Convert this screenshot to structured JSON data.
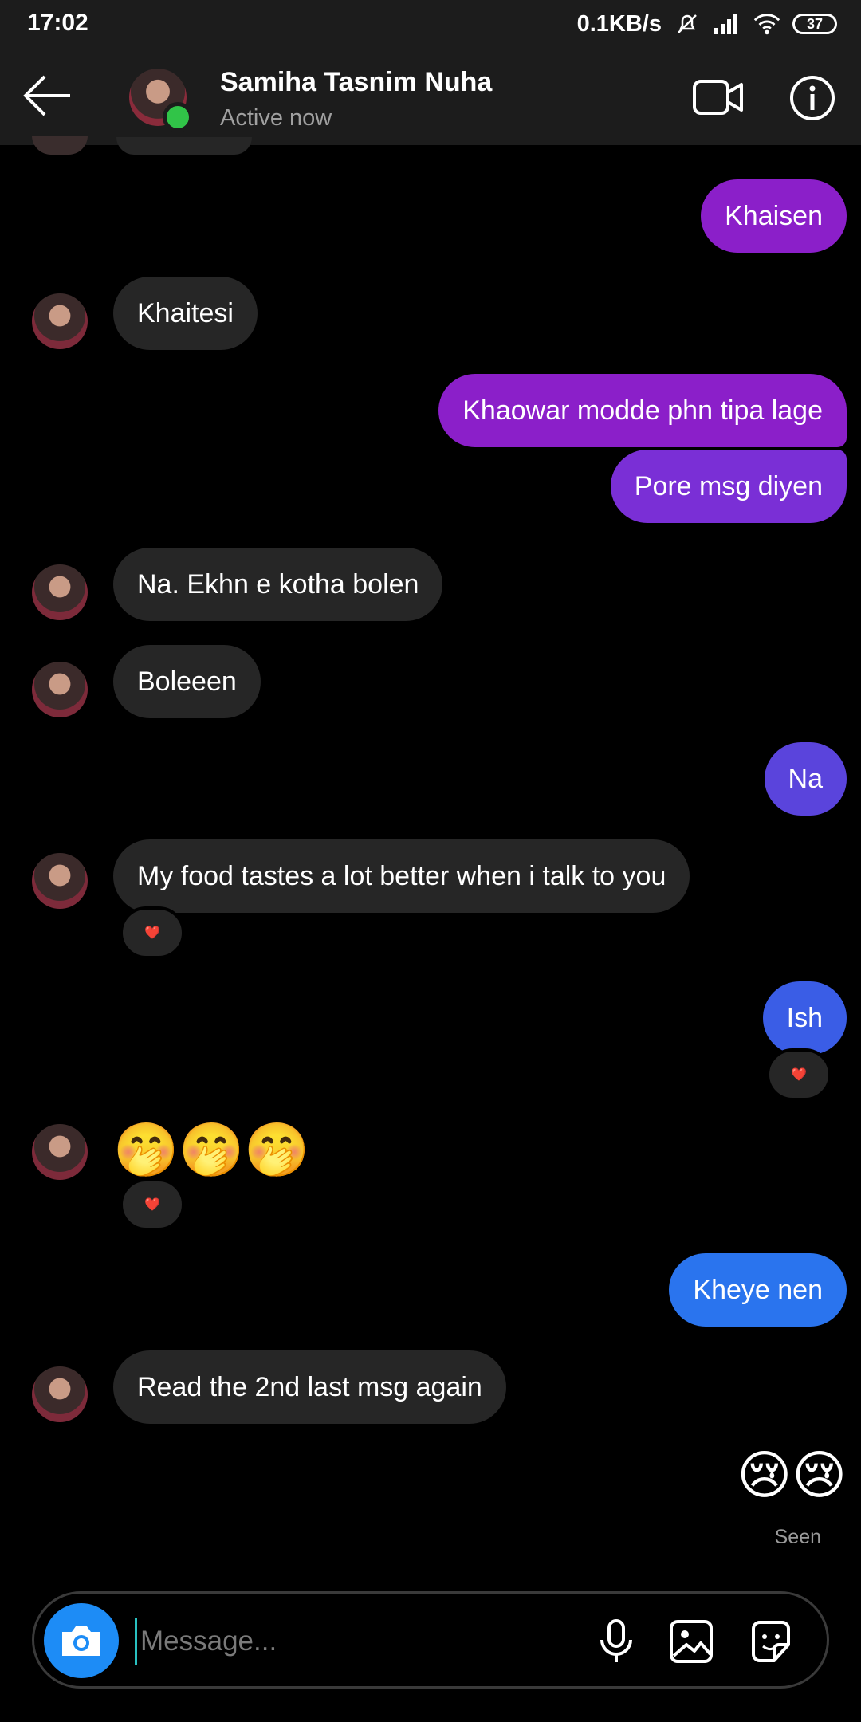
{
  "status_bar": {
    "time": "17:02",
    "net_speed": "0.1KB/s",
    "battery": "37",
    "icons": [
      "bell-muted-icon",
      "signal-icon",
      "wifi-icon",
      "battery-icon"
    ]
  },
  "header": {
    "name": "Samiha Tasnim Nuha",
    "status": "Active now",
    "online_color": "#31c448"
  },
  "messages": {
    "m1": "Khaisen",
    "m2": "Khaitesi",
    "m3": "Khaowar modde phn tipa lage",
    "m4": "Pore msg diyen",
    "m5": "Na. Ekhn e kotha bolen",
    "m6": "Boleeen",
    "m7": "Na",
    "m8": "My food tastes a lot better when i talk to you",
    "m9": "Ish",
    "m10": "🤭🤭🤭",
    "m11": "Kheye nen",
    "m12": "Read the 2nd last msg again",
    "m13": "😢😢"
  },
  "reactions": {
    "heart": "❤️"
  },
  "seen_label": "Seen",
  "composer": {
    "placeholder": "Message..."
  },
  "colors": {
    "incoming": "#262626",
    "outgoing_purple": "#8b1fc9",
    "outgoing_violet": "#7a2fd6",
    "outgoing_indigo": "#5a44dc",
    "outgoing_blue": "#3a5de6",
    "outgoing_azure": "#2a74ee",
    "camera_button": "#1d8cf6"
  }
}
